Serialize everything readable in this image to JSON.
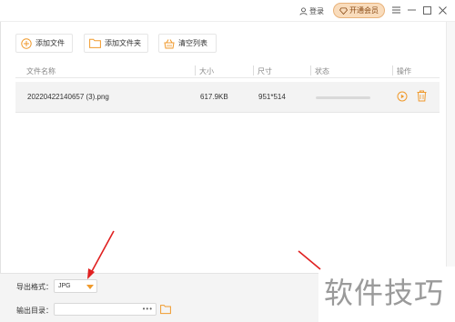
{
  "titlebar": {
    "login_label": "登录",
    "vip_label": "开通会员",
    "controls": [
      "menu-icon",
      "minimize-icon",
      "maximize-icon",
      "close-icon"
    ]
  },
  "toolbar": {
    "add_file": "添加文件",
    "add_folder": "添加文件夹",
    "clear_list": "清空列表"
  },
  "table": {
    "headers": {
      "name": "文件名称",
      "size": "大小",
      "dimensions": "尺寸",
      "status": "状态",
      "actions": "操作"
    },
    "rows": [
      {
        "name": "20220422140657 (3).png",
        "size": "617.9KB",
        "dimensions": "951*514",
        "progress": 0
      }
    ]
  },
  "bottom": {
    "format_label": "导出格式：",
    "format_value": "JPG",
    "output_label": "输出目录：",
    "output_value": "",
    "browse_dots": "•••"
  },
  "watermark": "软件技巧",
  "colors": {
    "accent": "#f09a2c",
    "vip_bg": "#f9dcbc",
    "annotation_arrow": "#e02020"
  }
}
